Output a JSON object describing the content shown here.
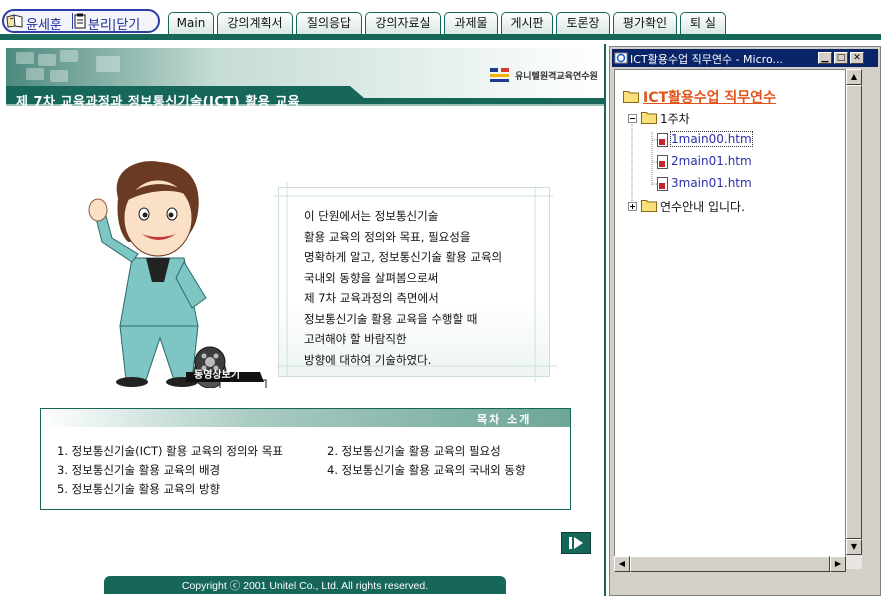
{
  "topbar": {
    "user_name": "윤세훈",
    "split_label": "분리",
    "close_label": "닫기",
    "tabs": [
      "Main",
      "강의계획서",
      "질의응답",
      "강의자료실",
      "과제물",
      "게시판",
      "토론장",
      "평가확인",
      "퇴 실"
    ]
  },
  "main": {
    "banner_title": "제 7차 교육과정과 정보통신기술(ICT) 활용 교육",
    "org_name": "유니텔원격교육연수원",
    "video_label": "동영상보기",
    "intro_lines": [
      "이 단원에서는 정보통신기술",
      "활용 교육의 정의와 목표, 필요성을",
      "명확하게 알고, 정보통신기술 활용 교육의",
      "국내외 동향을 살펴봄으로써",
      "제 7차 교육과정의 측면에서",
      "정보통신기술 활용 교육을 수행할 때",
      "고려해야 할 바람직한",
      "방향에 대하여 기술하였다."
    ],
    "toc_title": "목차 소개",
    "toc_items": [
      "1. 정보통신기술(ICT) 활용 교육의 정의와  목표",
      "2. 정보통신기술 활용 교육의 필요성",
      "3. 정보통신기술 활용 교육의 배경",
      "4. 정보통신기술 활용 교육의 국내외 동향",
      "5. 정보통신기술 활용 교육의 방향"
    ],
    "footer": "Copyright ⓒ 2001 Unitel Co., Ltd.  All rights reserved."
  },
  "side": {
    "window_title": "ICT활용수업 직무연수 - Micro...",
    "tree_root": "ICT활용수업 직무연수",
    "week": "1주차",
    "files": [
      "1main00.htm",
      "2main01.htm",
      "3main01.htm"
    ],
    "info": "연수안내 입니다."
  },
  "colors": {
    "accent": "#17665a",
    "link": "#2b2fa6",
    "tree_root": "#e0541c",
    "titlebar": "#0a246a"
  }
}
